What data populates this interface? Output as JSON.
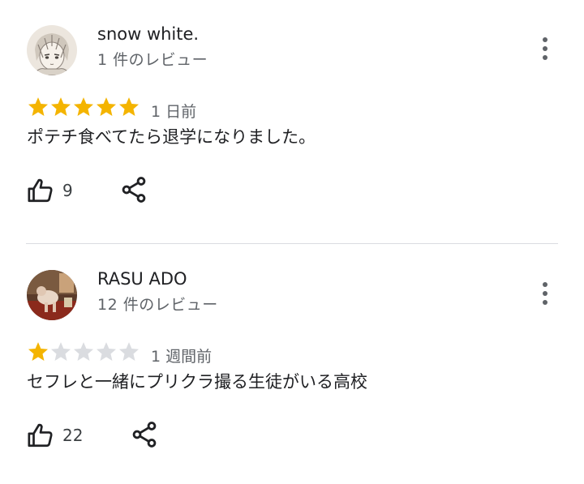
{
  "colors": {
    "star_filled": "#f4b400",
    "star_empty": "#dadce0",
    "secondary_text": "#5f6368",
    "divider": "#dadce0"
  },
  "reviews": [
    {
      "author": "snow white.",
      "review_count": "1 件のレビュー",
      "rating": 5,
      "max_rating": 5,
      "date": "1 日前",
      "text": "ポテチ食べてたら退学になりました。",
      "helpful_count": "9",
      "icons": {
        "avatar": "anime-sketch-avatar",
        "more": "more-vert-icon",
        "helpful": "thumb-up-icon",
        "share": "share-icon"
      }
    },
    {
      "author": "RASU ADO",
      "review_count": "12 件のレビュー",
      "rating": 1,
      "max_rating": 5,
      "date": "1 週間前",
      "text": "セフレと一緒にプリクラ撮る生徒がいる高校",
      "helpful_count": "22",
      "icons": {
        "avatar": "photo-avatar",
        "more": "more-vert-icon",
        "helpful": "thumb-up-icon",
        "share": "share-icon"
      }
    }
  ]
}
